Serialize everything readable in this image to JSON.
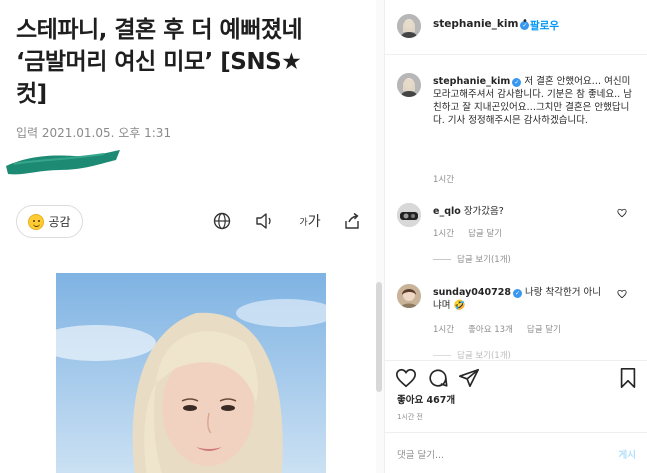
{
  "article": {
    "headline_line1": "스테파니, 결혼 후 더 예뻐졌네",
    "headline_line2": "‘금발머리 여신 미모’ [SNS★",
    "headline_line3": "컷]",
    "date": "입력 2021.01.05. 오후 1:31",
    "empathy_label": "공감",
    "font_size_small": "가",
    "font_size_large": "가"
  },
  "instagram": {
    "header": {
      "username": "stephanie_kim",
      "dot": "•",
      "follow": "팔로우"
    },
    "caption": {
      "username": "stephanie_kim",
      "text": "저 결혼 안했어요… 여신미모라고해주셔서 감사합니다. 기분은 참 좋네요.. 남친하고 잘 지내곤있어요…그치만 결혼은 안했답니다. 기사 정정해주시믄 감사하겠습니다.",
      "time": "1시간"
    },
    "comments": [
      {
        "username": "e_qlo",
        "text": "장가갔음?",
        "time": "1시간",
        "reply": "답글 달기",
        "view_replies": "답글 보기(1개)"
      },
      {
        "username": "sunday040728",
        "text": "나랑 착각한거 아니냐며 🤣",
        "time": "1시간",
        "likes": "좋아요 13개",
        "reply": "답글 달기"
      }
    ],
    "partial_next": "답글 보기(1개)",
    "likes": "좋아요 467개",
    "time_ago": "1시간 전",
    "comment_placeholder": "댓글 달기...",
    "post_button": "게시"
  },
  "colors": {
    "accent_blue": "#0095f6",
    "verified_blue": "#3897f0",
    "meta_gray": "#8e8e8e",
    "green_mark": "#1d8a74"
  }
}
